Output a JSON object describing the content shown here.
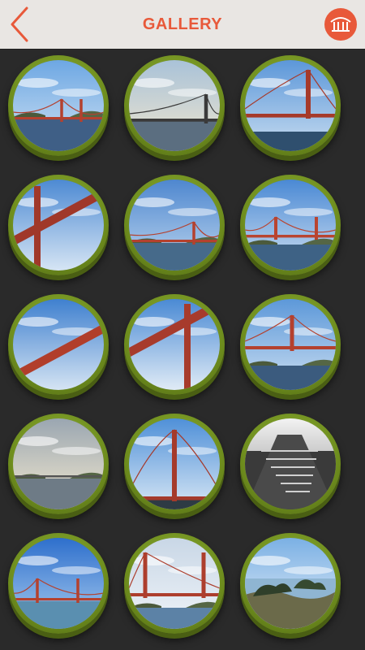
{
  "header": {
    "title": "GALLERY",
    "accent_color": "#e8593a",
    "back_icon": "chevron-left-icon",
    "logo_icon": "bridge-logo-icon"
  },
  "gallery": {
    "frame_color": "#7f9f26",
    "items": [
      {
        "scene": "bridge-distance-left"
      },
      {
        "scene": "bridge-sunset-cloudy"
      },
      {
        "scene": "tower-close-right"
      },
      {
        "scene": "tower-low-angle-left"
      },
      {
        "scene": "bridge-wide-clouds"
      },
      {
        "scene": "bridge-span-right"
      },
      {
        "scene": "deck-underside-angle"
      },
      {
        "scene": "tower-underside-right"
      },
      {
        "scene": "bridge-from-water"
      },
      {
        "scene": "sunset-over-bay"
      },
      {
        "scene": "roadway-towers"
      },
      {
        "scene": "bw-walkway"
      },
      {
        "scene": "bridge-clear-sky"
      },
      {
        "scene": "bridge-towers-hills"
      },
      {
        "scene": "coastal-cypress"
      }
    ]
  }
}
